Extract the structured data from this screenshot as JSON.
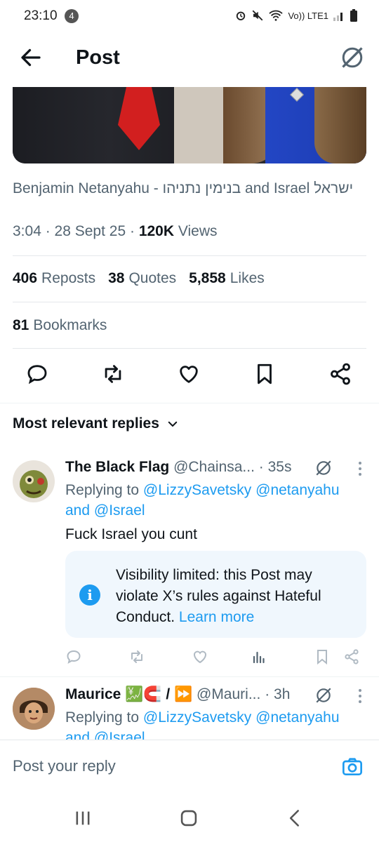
{
  "status": {
    "time": "23:10",
    "notif_count": "4",
    "network": "Vo)) LTE1"
  },
  "header": {
    "title": "Post"
  },
  "post": {
    "author_line": "Benjamin Netanyahu - בנימין נתניהו and Israel ישראל",
    "time": "3:04",
    "date": "28 Sept 25",
    "views_count": "120K",
    "views_label": "Views",
    "reposts_count": "406",
    "reposts_label": "Reposts",
    "quotes_count": "38",
    "quotes_label": "Quotes",
    "likes_count": "5,858",
    "likes_label": "Likes",
    "bookmarks_count": "81",
    "bookmarks_label": "Bookmarks"
  },
  "replies_sort": "Most relevant replies",
  "replies": [
    {
      "name": "The Black Flag",
      "handle": "@Chainsa...",
      "time": "· 35s",
      "replying_prefix": "Replying to",
      "replying_to_1": "@LizzySavetsky",
      "replying_to_2": "@netanyahu",
      "replying_and": "and",
      "replying_to_3": "@Israel",
      "text": "Fuck Israel you cunt",
      "notice_text": "Visibility limited: this Post may violate X’s rules against Hateful Conduct.",
      "notice_link": "Learn more"
    },
    {
      "name": "Maurice 💹🧲 / ⏩",
      "handle": "@Mauri...",
      "time": "· 3h",
      "replying_prefix": "Replying to",
      "replying_to_1": "@LizzySavetsky",
      "replying_to_2": "@netanyahu",
      "replying_and": "and",
      "replying_to_3": "@Israel"
    }
  ],
  "compose": {
    "placeholder": "Post your reply"
  },
  "colors": {
    "accent": "#1d9bf0",
    "muted": "#536471",
    "text": "#0f1419"
  }
}
